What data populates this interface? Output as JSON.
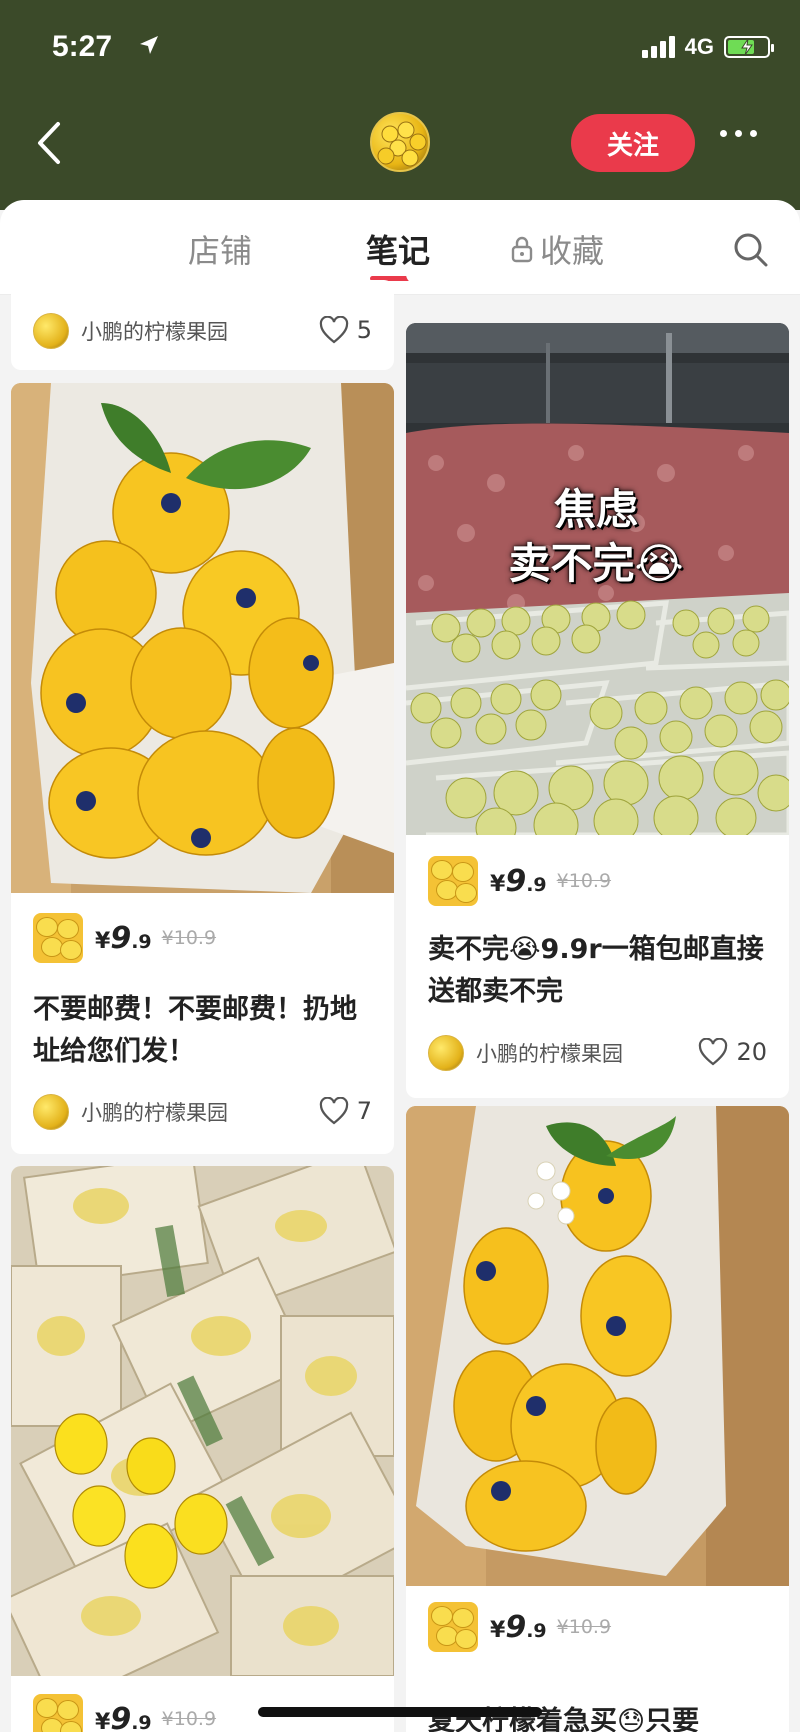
{
  "status_bar": {
    "time": "5:27",
    "network": "4G"
  },
  "header": {
    "follow_label": "关注"
  },
  "tabs": [
    {
      "label": "店铺",
      "active": false
    },
    {
      "label": "笔记",
      "active": true
    },
    {
      "label": "收藏",
      "active": false,
      "locked": true
    }
  ],
  "colors": {
    "header_bg": "#3b4a29",
    "accent": "#ea3a4b"
  },
  "feed": {
    "left": [
      {
        "author": "小鹏的柠檬果园",
        "likes": "5"
      },
      {
        "price_symbol": "¥",
        "price_int": "9",
        "price_dec": ".9",
        "old_price": "¥10.9",
        "title": "不要邮费！不要邮费！扔地址给您们发！",
        "author": "小鹏的柠檬果园",
        "likes": "7"
      },
      {
        "price_symbol": "¥",
        "price_int": "9",
        "price_dec": ".9",
        "old_price": "¥10.9"
      }
    ],
    "right": [
      {
        "overlay_line1": "焦虑",
        "overlay_line2": "卖不完😭",
        "price_symbol": "¥",
        "price_int": "9",
        "price_dec": ".9",
        "old_price": "¥10.9",
        "title": "卖不完😭9.9r一箱包邮直接送都卖不完",
        "author": "小鹏的柠檬果园",
        "likes": "20"
      },
      {
        "price_symbol": "¥",
        "price_int": "9",
        "price_dec": ".9",
        "old_price": "¥10.9",
        "title": "夏天柠檬着急买😓只要"
      }
    ]
  }
}
